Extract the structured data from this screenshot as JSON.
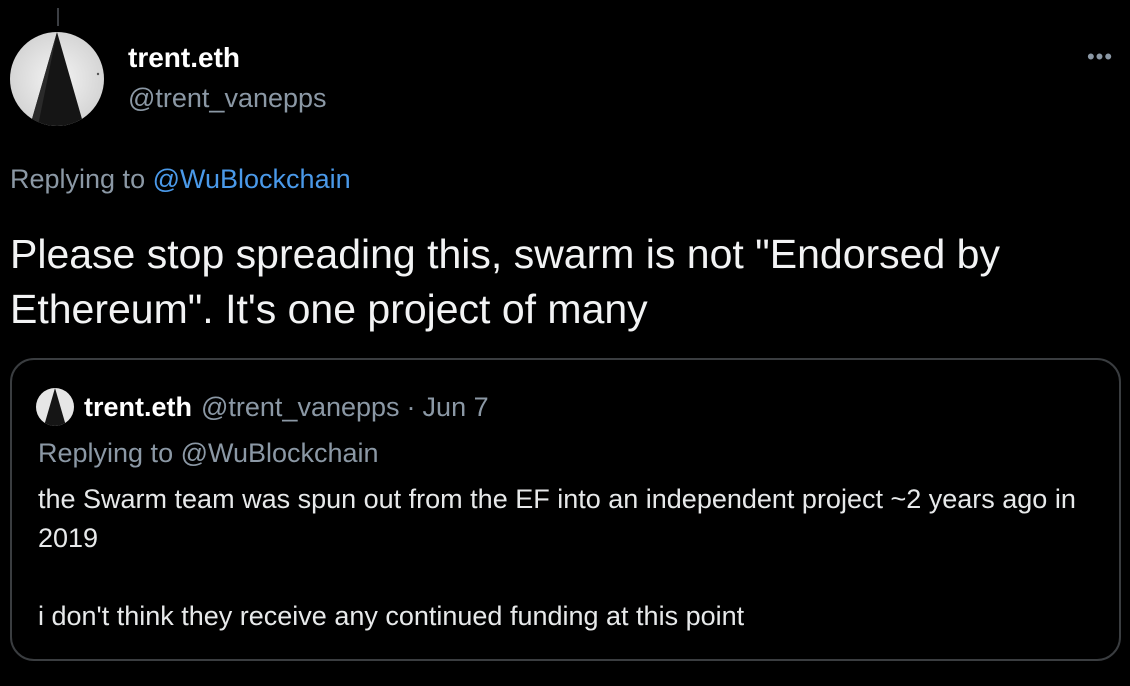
{
  "author": {
    "name": "trent.eth",
    "handle": "@trent_vanepps",
    "avatar_icon": "white-triangle-peak-avatar"
  },
  "more_icon": "more-options-icon",
  "more_label": "•••",
  "reply": {
    "prefix": "Replying to",
    "mention": "@WuBlockchain"
  },
  "tweet": {
    "text": "Please stop spreading this, swarm is not \"Endorsed by Ethereum\". It's one project of many"
  },
  "quote": {
    "name": "trent.eth",
    "handle": "@trent_vanepps",
    "separator": "·",
    "date": "Jun 7",
    "reply_text": "Replying to @WuBlockchain",
    "paragraph1": "the Swarm team was spun out from the EF into an independent project ~2 years ago in 2019",
    "paragraph2": "i don't think they receive any continued funding at this point"
  },
  "colors": {
    "background": "#000000",
    "mention_blue": "#4a99e9",
    "secondary_text": "#8b98a5",
    "border": "#3a3d40"
  }
}
